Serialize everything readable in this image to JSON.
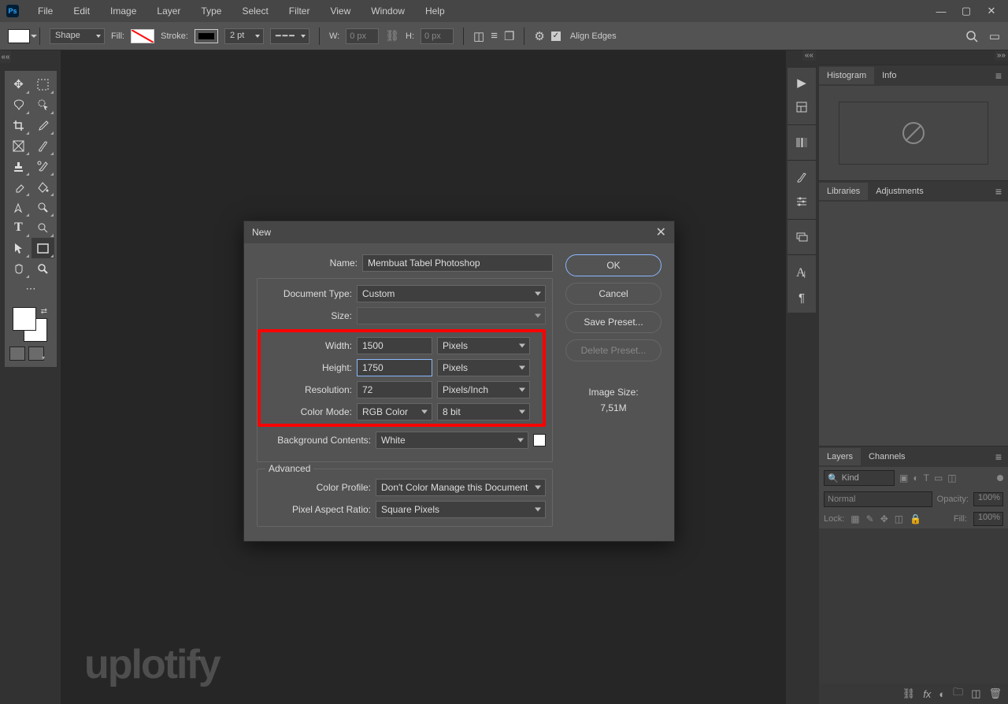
{
  "menu": [
    "File",
    "Edit",
    "Image",
    "Layer",
    "Type",
    "Select",
    "Filter",
    "View",
    "Window",
    "Help"
  ],
  "options": {
    "shape": "Shape",
    "fill": "Fill:",
    "stroke": "Stroke:",
    "strokeWidth": "2 pt",
    "wLabel": "W:",
    "wVal": "0 px",
    "hLabel": "H:",
    "hVal": "0 px",
    "alignEdges": "Align Edges"
  },
  "dialog": {
    "title": "New",
    "nameLabel": "Name:",
    "nameValue": "Membuat Tabel Photoshop",
    "docTypeLabel": "Document Type:",
    "docTypeValue": "Custom",
    "sizeLabel": "Size:",
    "widthLabel": "Width:",
    "widthValue": "1500",
    "widthUnit": "Pixels",
    "heightLabel": "Height:",
    "heightValue": "1750",
    "heightUnit": "Pixels",
    "resLabel": "Resolution:",
    "resValue": "72",
    "resUnit": "Pixels/Inch",
    "modeLabel": "Color Mode:",
    "modeValue": "RGB Color",
    "modeBits": "8 bit",
    "bgLabel": "Background Contents:",
    "bgValue": "White",
    "advanced": "Advanced",
    "profileLabel": "Color Profile:",
    "profileValue": "Don't Color Manage this Document",
    "pixelLabel": "Pixel Aspect Ratio:",
    "pixelValue": "Square Pixels",
    "ok": "OK",
    "cancel": "Cancel",
    "savePreset": "Save Preset...",
    "deletePreset": "Delete Preset...",
    "imgSizeLabel": "Image Size:",
    "imgSizeValue": "7,51M"
  },
  "panels": {
    "histogram": "Histogram",
    "info": "Info",
    "libraries": "Libraries",
    "adjustments": "Adjustments",
    "layers": "Layers",
    "channels": "Channels",
    "kind": "Kind",
    "normal": "Normal",
    "opacity": "Opacity:",
    "opVal": "100%",
    "lock": "Lock:",
    "fill": "Fill:",
    "fillVal": "100%"
  },
  "watermark": "uplotify"
}
